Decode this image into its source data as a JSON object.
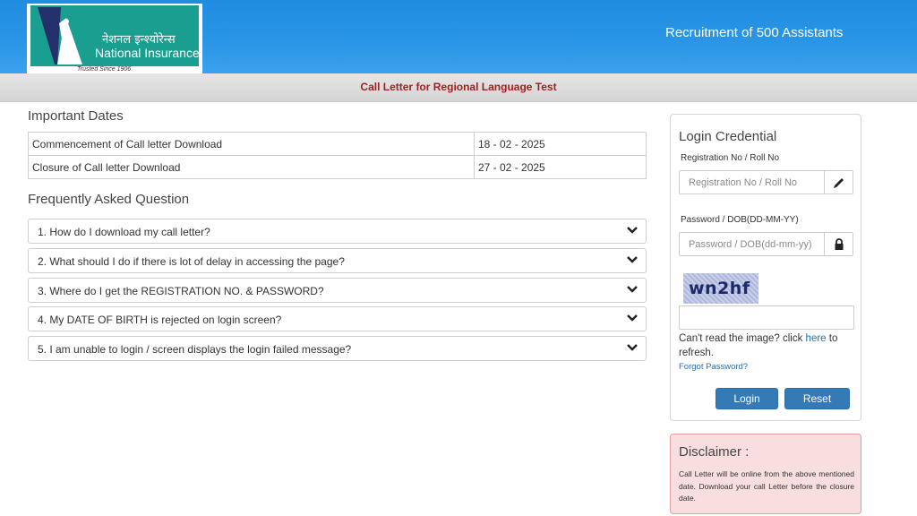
{
  "header": {
    "logo_hindi": "नेशनल इन्श्योरेन्स",
    "logo_english": "National Insurance",
    "logo_tagline": "Trusted Since 1906",
    "title": "Recruitment of 500 Assistants",
    "colors": {
      "header_blue": "#2b96e6",
      "logo_teal": "#1a9e8f"
    }
  },
  "subbar": {
    "title": "Call Letter for Regional Language Test",
    "title_color": "#a12020"
  },
  "important_dates": {
    "heading": "Important Dates",
    "rows": [
      {
        "label": "Commencement of Call letter Download",
        "date": "18 - 02 - 2025"
      },
      {
        "label": "Closure of Call letter Download",
        "date": "27 - 02 - 2025"
      }
    ]
  },
  "faq": {
    "heading": "Frequently Asked Question",
    "icon": "chevron-down-icon",
    "items": [
      "1. How do I download my call letter?",
      "2. What should I do if there is lot of delay in accessing the page?",
      "3. Where do I get the REGISTRATION NO. & PASSWORD?",
      "4. My DATE OF BIRTH is rejected on login screen?",
      "5. I am unable to login / screen displays the login failed message?"
    ]
  },
  "login": {
    "heading": "Login Credential",
    "reg_label": "Registration No / Roll No",
    "reg_placeholder": "Registration No / Roll No",
    "reg_icon": "pencil-icon",
    "pwd_label": "Password / DOB(DD-MM-YY)",
    "pwd_placeholder": "Password / DOB(dd-mm-yy)",
    "pwd_icon": "lock-icon",
    "captcha_text": "wn2hf",
    "cant_read_prefix": "Can't read the image? click ",
    "cant_read_link": "here",
    "cant_read_suffix": " to refresh.",
    "forgot_password": "Forgot Password?",
    "login_button": "Login",
    "reset_button": "Reset",
    "button_color": "#337ab7"
  },
  "disclaimer": {
    "title": "Disclaimer :",
    "text": "Call Letter will be online from the above mentioned date. Download your call Letter before the closure date.",
    "bg_color": "#f8dede"
  }
}
